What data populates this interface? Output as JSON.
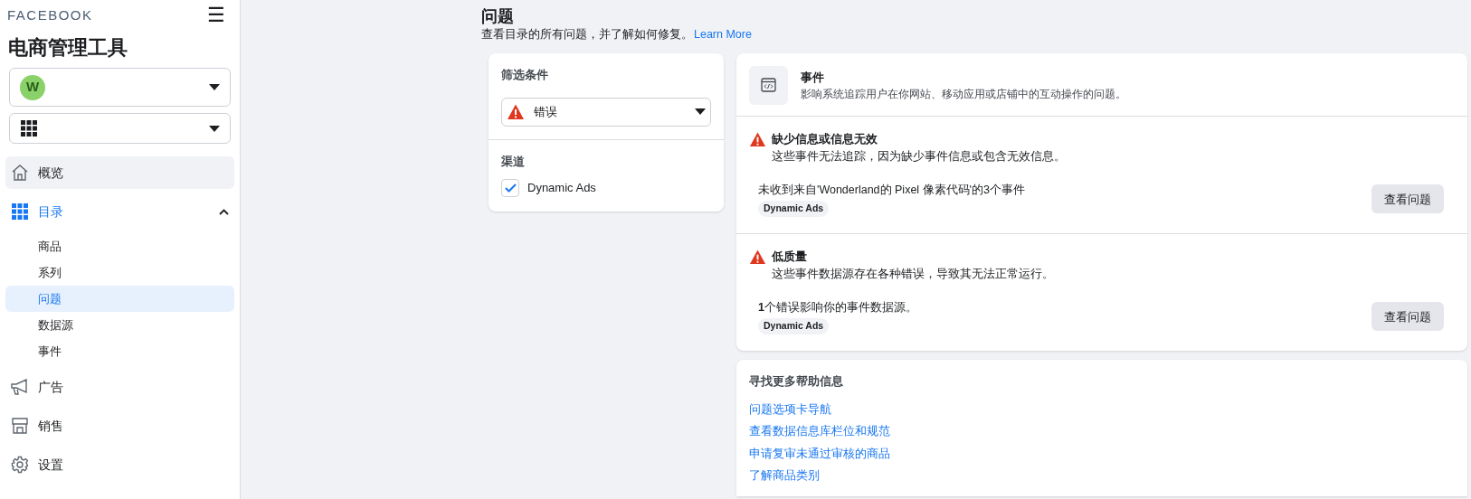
{
  "sidebar": {
    "brand": "FACEBOOK",
    "menu_icon": "☰",
    "title": "电商管理工具",
    "account_select": {
      "avatar_letter": "W"
    },
    "items": [
      {
        "kind": "home",
        "label": "概览",
        "selected": false,
        "hovered": true
      },
      {
        "kind": "catalog",
        "label": "目录",
        "selected": true,
        "expanded": true,
        "children": [
          {
            "label": "商品",
            "selected": false
          },
          {
            "label": "系列",
            "selected": false
          },
          {
            "label": "问题",
            "selected": true
          },
          {
            "label": "数据源",
            "selected": false
          },
          {
            "label": "事件",
            "selected": false
          }
        ]
      },
      {
        "kind": "ads",
        "label": "广告",
        "selected": false
      },
      {
        "kind": "sales",
        "label": "销售",
        "selected": false
      },
      {
        "kind": "settings",
        "label": "设置",
        "selected": false
      }
    ]
  },
  "page": {
    "title": "问题",
    "subtitle": "查看目录的所有问题，并了解如何修复。",
    "learn_more": "Learn More"
  },
  "filters": {
    "title": "筛选条件",
    "severity": "错误",
    "channel_title": "渠道",
    "channels": [
      {
        "label": "Dynamic Ads",
        "checked": true
      }
    ]
  },
  "events_card": {
    "title": "事件",
    "description": "影响系统追踪用户在你网站、移动应用或店铺中的互动操作的问题。",
    "sections": [
      {
        "title": "缺少信息或信息无效",
        "description": "这些事件无法追踪，因为缺少事件信息或包含无效信息。",
        "issue": "未收到来自'Wonderland的 Pixel 像素代码'的3个事件",
        "tag": "Dynamic Ads",
        "button": "查看问题"
      },
      {
        "title": "低质量",
        "description": "这些事件数据源存在各种错误，导致其无法正常运行。",
        "issue": "**1**个错误影响你的事件数据源。",
        "tag": "Dynamic Ads",
        "button": "查看问题"
      }
    ]
  },
  "help": {
    "title": "寻找更多帮助信息",
    "links": [
      "问题选项卡导航",
      "查看数据信息库栏位和规范",
      "申请复审未通过审核的商品",
      "了解商品类别"
    ]
  }
}
